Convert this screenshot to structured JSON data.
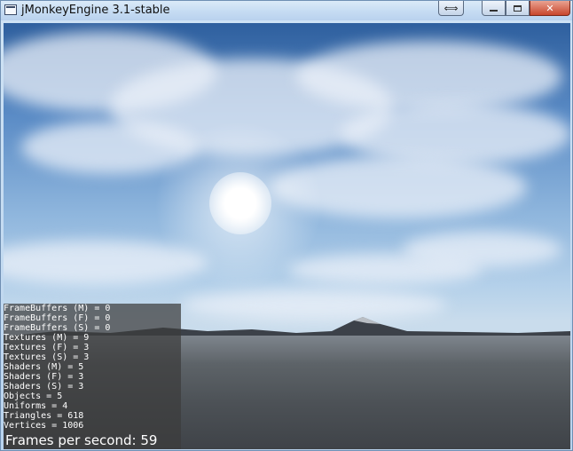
{
  "window": {
    "title": "jMonkeyEngine 3.1-stable",
    "buttons": {
      "resize_icon": "resize-arrows-icon",
      "minimize_icon": "minimize-icon",
      "maximize_icon": "maximize-icon",
      "close_label": "✕"
    }
  },
  "stats": [
    "FrameBuffers (M) = 0",
    "FrameBuffers (F) = 0",
    "FrameBuffers (S) = 0",
    "Textures (M) = 9",
    "Textures (F) = 3",
    "Textures (S) = 3",
    "Shaders (M) = 5",
    "Shaders (F) = 3",
    "Shaders (S) = 3",
    "Objects = 5",
    "Uniforms = 4",
    "Triangles = 618",
    "Vertices = 1006"
  ],
  "fps": "Frames per second: 59",
  "colors": {
    "sky_top": "#2e5f9e",
    "sky_horizon": "#c9dcec",
    "ground": "#4c5156",
    "overlay_text": "#ffffff"
  }
}
